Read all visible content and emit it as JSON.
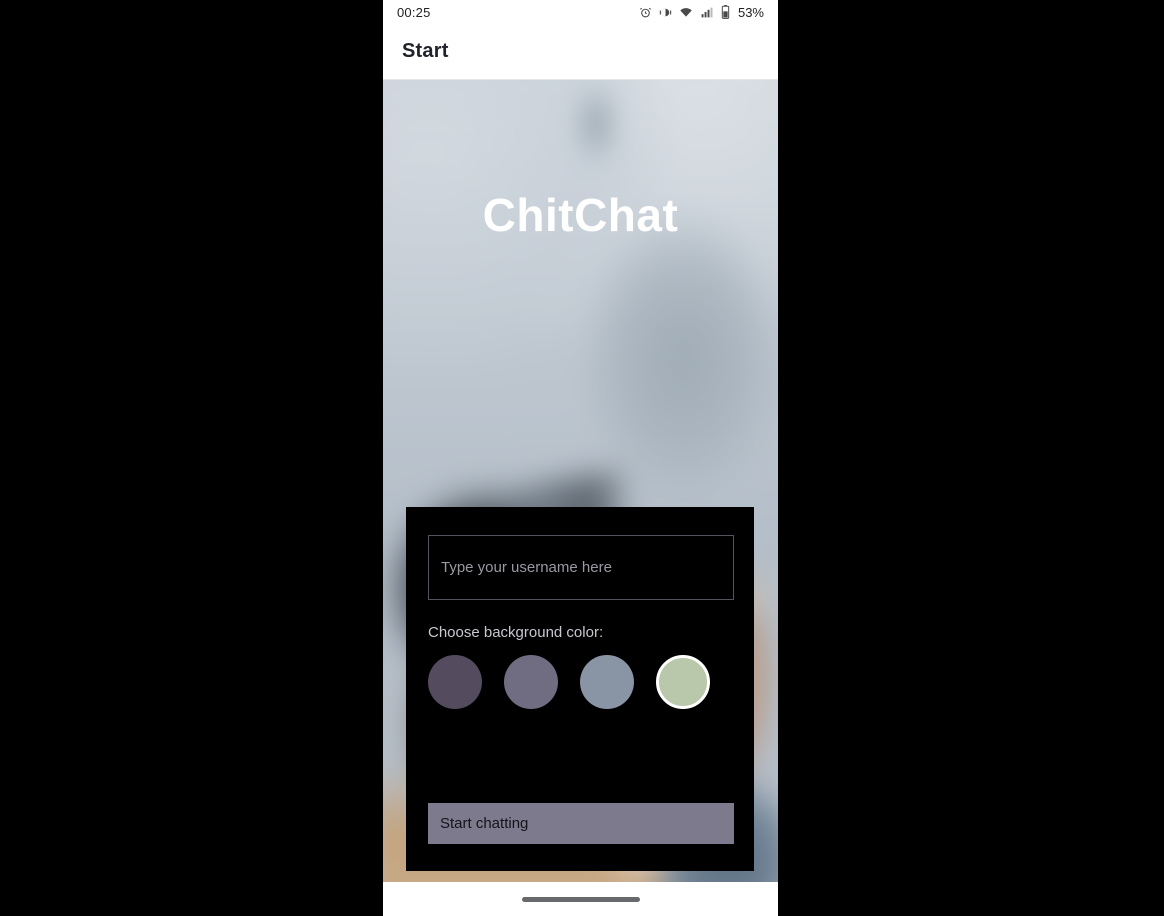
{
  "status_bar": {
    "clock": "00:25",
    "battery_percent": "53%",
    "icons": [
      "alarm-icon",
      "vibrate-icon",
      "wifi-icon",
      "signal-icon",
      "battery-icon"
    ]
  },
  "app_bar": {
    "title": "Start"
  },
  "hero": {
    "title": "ChitChat"
  },
  "form": {
    "username": {
      "value": "",
      "placeholder": "Type your username here"
    },
    "color_label": "Choose background color:",
    "swatches": [
      {
        "name": "dark-purple",
        "color": "#544b5e",
        "selected": false
      },
      {
        "name": "grey-purple",
        "color": "#706c81",
        "selected": false
      },
      {
        "name": "blue-grey",
        "color": "#8994a5",
        "selected": false
      },
      {
        "name": "sage-green",
        "color": "#b9c8ab",
        "selected": true
      }
    ],
    "start_button": {
      "label": "Start chatting",
      "color": "#7c7a8c"
    }
  },
  "nav_bar": {
    "gesture_pill": "gesture-pill"
  }
}
